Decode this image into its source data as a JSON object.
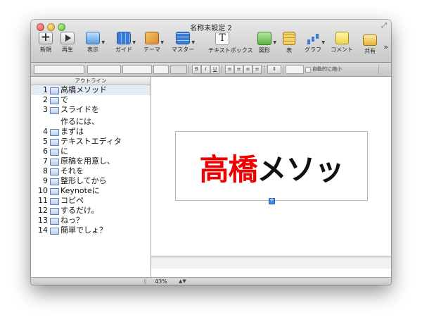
{
  "window": {
    "title": "名称未設定 2"
  },
  "toolbar": {
    "new": "新規",
    "play": "再生",
    "view": "表示",
    "guide": "ガイド",
    "theme": "テーマ",
    "master": "マスター",
    "textbox": "テキストボックス",
    "shape": "図形",
    "table": "表",
    "chart": "グラフ",
    "comment": "コメント",
    "share": "共有",
    "more": "»"
  },
  "formatbar": {
    "bold": "B",
    "italic": "I",
    "underline": "U",
    "autoshrink_label": "自動的に縮小"
  },
  "outline": {
    "header": "アウトライン",
    "items": [
      {
        "num": "1",
        "text": "高橋メソッド"
      },
      {
        "num": "2",
        "text": "で"
      },
      {
        "num": "3",
        "text": "スライドを"
      },
      {
        "num": "",
        "text": "作るには、"
      },
      {
        "num": "4",
        "text": "まずは"
      },
      {
        "num": "5",
        "text": "テキストエディタ"
      },
      {
        "num": "6",
        "text": "に"
      },
      {
        "num": "7",
        "text": "原稿を用意し、"
      },
      {
        "num": "8",
        "text": "それを"
      },
      {
        "num": "9",
        "text": "整形してから"
      },
      {
        "num": "10",
        "text": "Keynoteに"
      },
      {
        "num": "11",
        "text": "コピペ"
      },
      {
        "num": "12",
        "text": "するだけ。"
      },
      {
        "num": "13",
        "text": "ねっ？"
      },
      {
        "num": "14",
        "text": "簡単でしょ？"
      }
    ]
  },
  "slide": {
    "title_red": "高橋",
    "title_black": "メソッ"
  },
  "status": {
    "zoom": "43%",
    "zoom_arrows": "▲▼"
  },
  "colors": {
    "title_red": "#f00000",
    "selection": "#e6ecf7"
  }
}
